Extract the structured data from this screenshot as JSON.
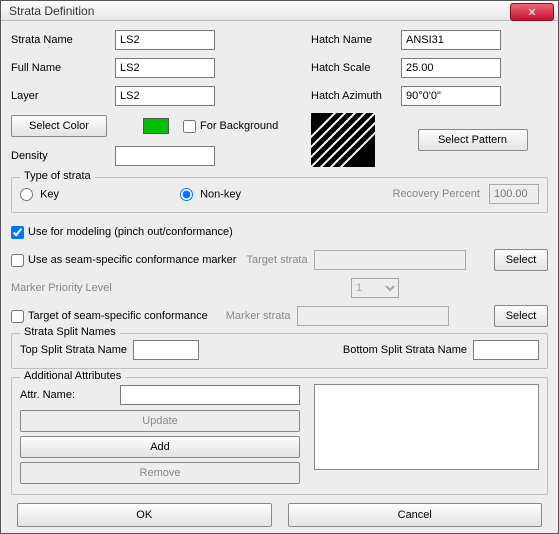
{
  "window": {
    "title": "Strata Definition"
  },
  "fields": {
    "strata_name_label": "Strata Name",
    "strata_name_value": "LS2",
    "full_name_label": "Full Name",
    "full_name_value": "LS2",
    "layer_label": "Layer",
    "layer_value": "LS2",
    "hatch_name_label": "Hatch Name",
    "hatch_name_value": "ANSI31",
    "hatch_scale_label": "Hatch Scale",
    "hatch_scale_value": "25.00",
    "hatch_azimuth_label": "Hatch Azimuth",
    "hatch_azimuth_value": "90°0'0\"",
    "select_color_btn": "Select Color",
    "color_swatch_hex": "#00c000",
    "for_background_label": "For Background",
    "for_background_checked": false,
    "density_label": "Density",
    "density_value": "",
    "select_pattern_btn": "Select Pattern"
  },
  "type_of_strata": {
    "legend": "Type of strata",
    "key_label": "Key",
    "nonkey_label": "Non-key",
    "selected": "nonkey",
    "recovery_percent_label": "Recovery Percent",
    "recovery_percent_value": "100.00"
  },
  "modeling": {
    "use_for_modeling_label": "Use for modeling (pinch out/conformance)",
    "use_for_modeling_checked": true,
    "use_as_marker_label": "Use as seam-specific conformance marker",
    "use_as_marker_checked": false,
    "target_strata_label": "Target strata",
    "target_strata_value": "",
    "select_btn": "Select",
    "marker_priority_label": "Marker Priority Level",
    "marker_priority_value": "1",
    "target_of_conformance_label": "Target of seam-specific conformance",
    "target_of_conformance_checked": false,
    "marker_strata_label": "Marker strata",
    "marker_strata_value": ""
  },
  "split_names": {
    "legend": "Strata Split Names",
    "top_label": "Top Split Strata Name",
    "top_value": "",
    "bottom_label": "Bottom Split Strata Name",
    "bottom_value": ""
  },
  "additional": {
    "legend": "Additional Attributes",
    "attr_name_label": "Attr. Name:",
    "attr_name_value": "",
    "update_btn": "Update",
    "add_btn": "Add",
    "remove_btn": "Remove",
    "list_value": ""
  },
  "buttons": {
    "ok": "OK",
    "cancel": "Cancel"
  }
}
